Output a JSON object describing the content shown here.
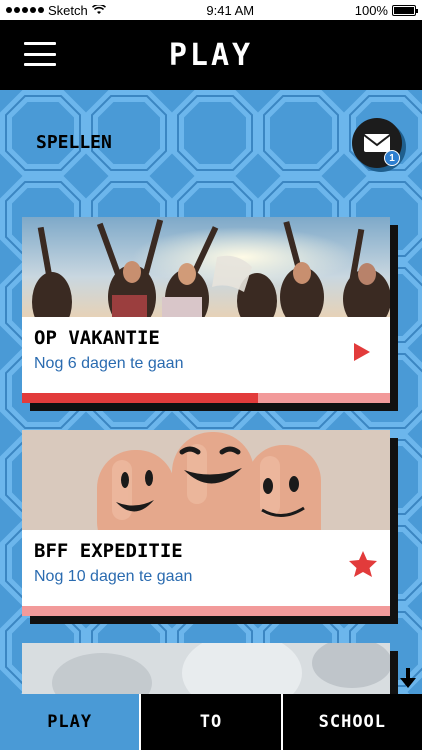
{
  "status_bar": {
    "carrier": "Sketch",
    "time": "9:41 AM",
    "battery": "100%"
  },
  "header": {
    "title": "PLAY",
    "menu_icon": "hamburger-icon"
  },
  "section": {
    "title": "SPELLEN"
  },
  "mail": {
    "icon": "envelope-icon",
    "badge_count": "1"
  },
  "cards": [
    {
      "title": "OP VAKANTIE",
      "subtitle": "Nog 6 dagen te gaan",
      "action_icon": "play-triangle-icon",
      "progress": 0.64
    },
    {
      "title": "BFF EXPEDITIE",
      "subtitle": "Nog 10 dagen te gaan",
      "action_icon": "star-icon",
      "progress": 0.0
    }
  ],
  "tabs": [
    {
      "label": "PLAY",
      "active": true
    },
    {
      "label": "TO",
      "active": false
    },
    {
      "label": "SCHOOL",
      "active": false
    }
  ],
  "colors": {
    "accent_blue": "#4a9ad6",
    "accent_red": "#e23b3b",
    "subtitle_blue": "#2a6bb0"
  }
}
